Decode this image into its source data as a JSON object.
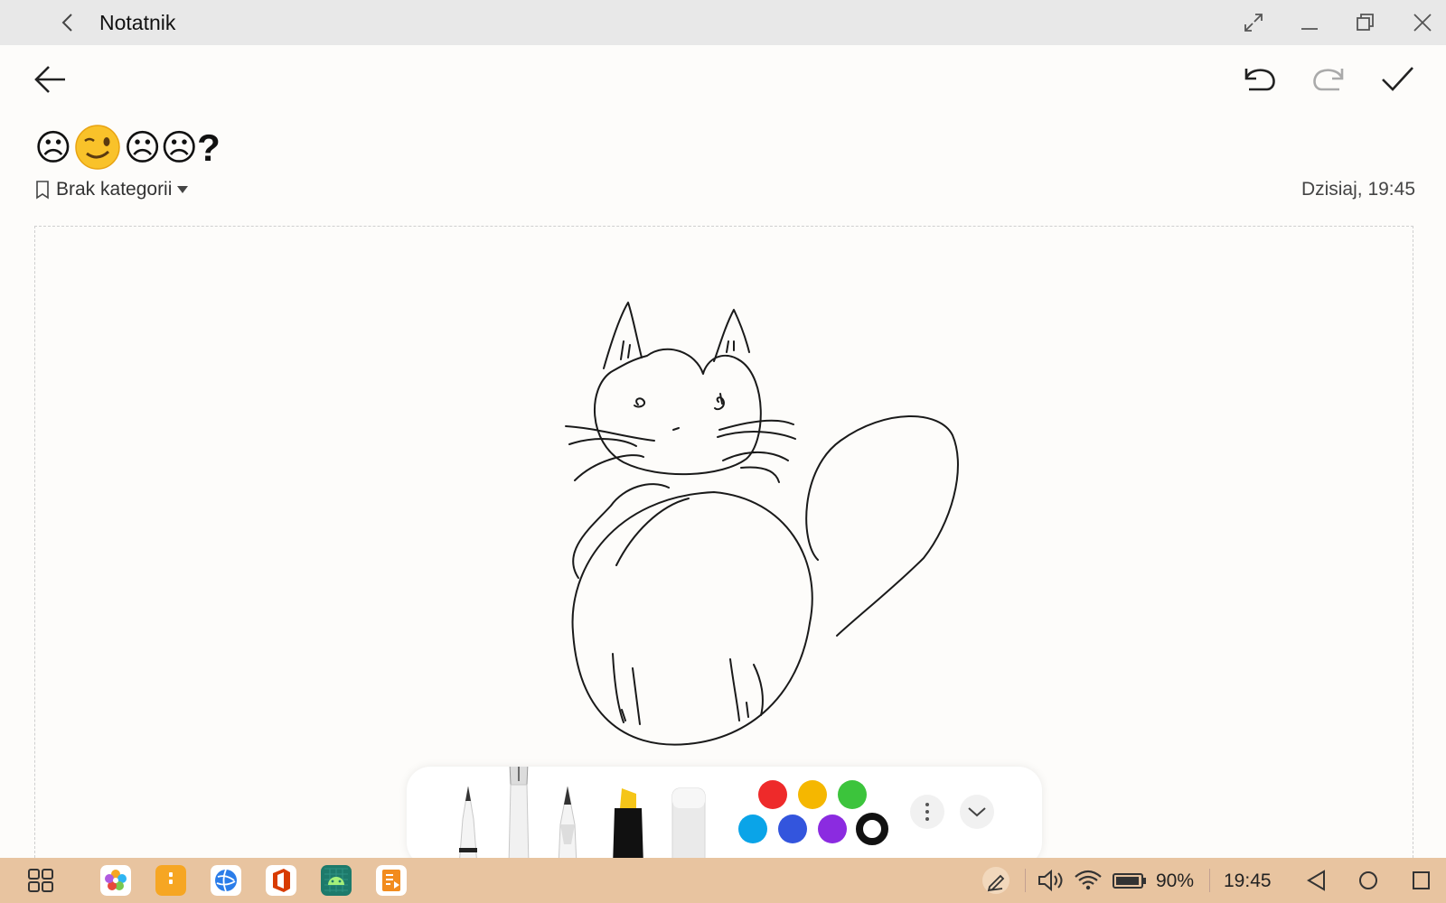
{
  "window": {
    "title": "Notatnik"
  },
  "note": {
    "title_faces": [
      "☹",
      "😉",
      "☹",
      "☹",
      "?"
    ],
    "category": "Brak kategorii",
    "date": "Dzisiaj, 19:45"
  },
  "pen_toolbar": {
    "tools": [
      "ballpoint-pen",
      "fountain-pen",
      "pencil",
      "highlighter",
      "eraser"
    ],
    "selected_tool": "fountain-pen",
    "colors": [
      "#ee2a2a",
      "#f5b700",
      "#3cc43c",
      "#0aa4e8",
      "#3355dd",
      "#8b2be0",
      "#111111"
    ],
    "selected_color": "#111111"
  },
  "taskbar": {
    "battery": "90%",
    "time": "19:45"
  },
  "colors": {
    "titlebar": "#e8e8e8",
    "taskbar": "#e8c4a0",
    "canvas": "#fdfcfa"
  }
}
